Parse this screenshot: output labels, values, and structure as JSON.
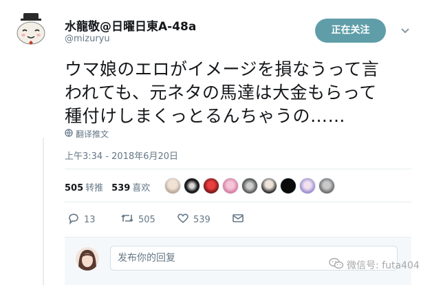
{
  "user": {
    "display_name": "水龍敬@日曜日東A-48a",
    "handle": "@mizuryu"
  },
  "follow_button": {
    "label": "正在关注"
  },
  "tweet": {
    "lines": [
      "ウマ娘のエロがイメージを損なうって言",
      "われても、元ネタの馬達は大金もらって",
      "種付けしまくっとるんちゃうの……"
    ],
    "translate_label": "翻译推文",
    "timestamp": "上午3:34 - 2018年6月20日"
  },
  "stats": {
    "retweets_count": "505",
    "retweets_label": "转推",
    "likes_count": "539",
    "likes_label": "喜欢"
  },
  "actions": {
    "reply_count": "13",
    "retweet_count": "505",
    "like_count": "539"
  },
  "reply": {
    "placeholder": "发布你的回复"
  },
  "watermark": {
    "text": "微信号: futa404"
  },
  "colors": {
    "follow_button": "#5f9ea8",
    "secondary_text": "#657786",
    "divider": "#e6ecf0"
  }
}
